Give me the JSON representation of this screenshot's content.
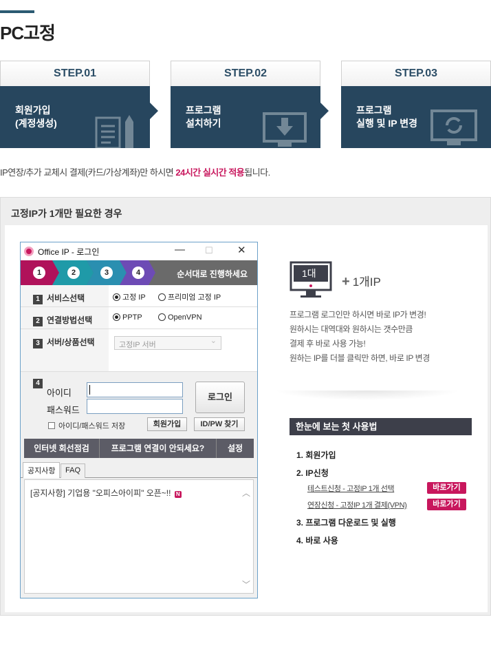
{
  "page": {
    "title": "PC고정",
    "notice_prefix": "IP연장/추가 교체시 결제(카드/가상계좌)만 하시면 ",
    "notice_highlight": "24시간 실시간 적용",
    "notice_suffix": "됩니다."
  },
  "steps": [
    {
      "label": "STEP.01",
      "text": "회원가입\n(계정생성)",
      "icon": "document-pencil-icon"
    },
    {
      "label": "STEP.02",
      "text": "프로그램\n설치하기",
      "icon": "monitor-download-icon"
    },
    {
      "label": "STEP.03",
      "text": "프로그램\n실행 및 IP 변경",
      "icon": "monitor-refresh-icon"
    }
  ],
  "case": {
    "title": "고정IP가 1개만 필요한 경우"
  },
  "login_window": {
    "title": "Office IP - 로그인",
    "controls": {
      "minimize": "—",
      "maximize": "☐",
      "close": "✕"
    },
    "step_numbers": [
      "1",
      "2",
      "3",
      "4"
    ],
    "step_label": "순서대로 진행하세요",
    "step_colors": [
      "#b0125a",
      "#1f9aa8",
      "#2a8fb0",
      "#6d4bb5"
    ],
    "service": {
      "num": "1",
      "label": "서비스선택",
      "options": [
        "고정 IP",
        "프리미엄 고정 IP"
      ],
      "selected": "고정 IP"
    },
    "connection": {
      "num": "2",
      "label": "연결방법선택",
      "options": [
        "PPTP",
        "OpenVPN"
      ],
      "selected": "PPTP"
    },
    "server": {
      "num": "3",
      "label": "서버/상품선택",
      "placeholder": "고정IP 서버"
    },
    "login": {
      "num": "4",
      "id_label": "아이디",
      "pw_label": "패스워드",
      "login_button": "로그인",
      "save_label": "아이디/패스워드 저장",
      "join_button": "회원가입",
      "find_button": "ID/PW 찾기"
    },
    "toolbar": [
      "인터넷 회선점검",
      "프로그램 연결이 안되세요?",
      "설정"
    ],
    "tabs": [
      "공지사항",
      "FAQ"
    ],
    "notice_text": "[공지사항] 기업용 \"오피스아이피\" 오픈~!!",
    "notice_badge": "N"
  },
  "right": {
    "monitor_text": "1대",
    "plus_ip": "1개IP",
    "desc_lines": [
      "프로그램 로그인만 하시면 바로 IP가 변경!",
      "원하시는 대역대와 원하시는 갯수만큼",
      "결제 후 바로 사용 가능!",
      "원하는 IP를 더블 클릭만 하면, 바로 IP 변경"
    ],
    "guide_title": "한눈에 보는 첫 사용법",
    "guide": [
      {
        "text": "1. 회원가입"
      },
      {
        "text": "2. IP신청"
      },
      {
        "text": "3. 프로그램 다운로드 및 실행"
      },
      {
        "text": "4. 바로 사용"
      }
    ],
    "guide_links": [
      {
        "text": "테스트신청 - 고정IP 1개 선택",
        "button": "바로가기"
      },
      {
        "text": "연장신청 - 고정IP 1개 결제(VPN)",
        "button": "바로가기"
      }
    ]
  },
  "colors": {
    "navy": "#27465e",
    "accent_pink": "#c8175d",
    "dark_header": "#3d3f4a"
  }
}
